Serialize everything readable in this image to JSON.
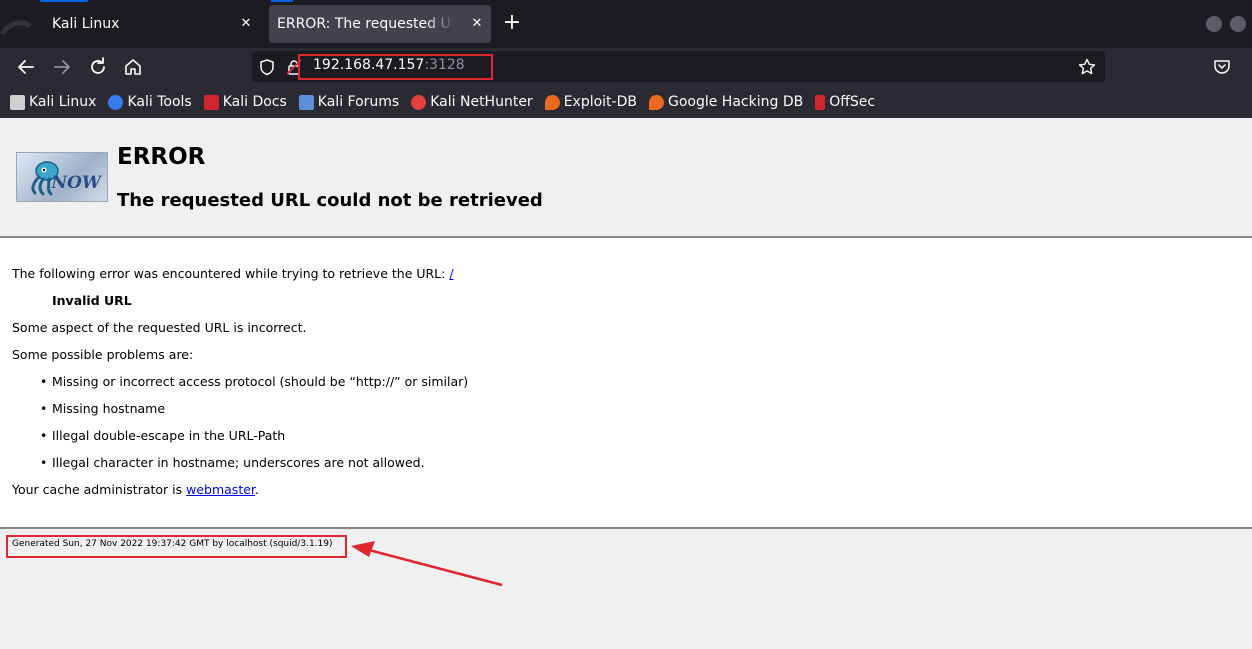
{
  "tabs": [
    {
      "label": "Kali Linux"
    },
    {
      "label": "ERROR: The requested URL could not be retrieved"
    }
  ],
  "navbar": {
    "url_host": "192.168.47.157",
    "url_port": ":3128"
  },
  "bookmarks": [
    {
      "label": "Kali Linux",
      "icon": "kali-dragon-icon",
      "color": "#d0d0d0"
    },
    {
      "label": "Kali Tools",
      "icon": "kali-tools-icon",
      "color": "#367bf0"
    },
    {
      "label": "Kali Docs",
      "icon": "kali-docs-icon",
      "color": "#d0252d"
    },
    {
      "label": "Kali Forums",
      "icon": "kali-forums-icon",
      "color": "#5b8fd8"
    },
    {
      "label": "Kali NetHunter",
      "icon": "nethunter-icon",
      "color": "#e0413a"
    },
    {
      "label": "Exploit-DB",
      "icon": "exploit-db-icon",
      "color": "#e86a1f"
    },
    {
      "label": "Google Hacking DB",
      "icon": "ghdb-icon",
      "color": "#e86a1f"
    },
    {
      "label": "OffSec",
      "icon": "offsec-icon",
      "color": "#d0252d"
    }
  ],
  "page": {
    "logo_text": "NOW",
    "heading": "ERROR",
    "subheading": "The requested URL could not be retrieved",
    "intro": "The following error was encountered while trying to retrieve the URL: ",
    "intro_link": "/",
    "error_name": "Invalid URL",
    "aspect": "Some aspect of the requested URL is incorrect.",
    "problems_intro": "Some possible problems are:",
    "problems": [
      "Missing or incorrect access protocol (should be “http://” or similar)",
      "Missing hostname",
      "Illegal double-escape in the URL-Path",
      "Illegal character in hostname; underscores are not allowed."
    ],
    "admin_prefix": "Your cache administrator is ",
    "admin_link": "webmaster",
    "admin_suffix": ".",
    "footer": "Generated Sun, 27 Nov 2022 19:37:42 GMT by localhost (squid/3.1.19)"
  },
  "colors": {
    "highlight": "#e0262f",
    "link": "#0000ee"
  }
}
